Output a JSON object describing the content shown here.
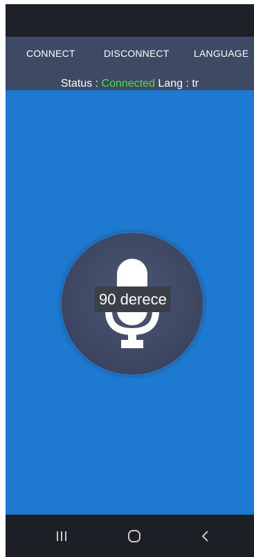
{
  "toolbar": {
    "connect_label": "CONNECT",
    "disconnect_label": "DISCONNECT",
    "language_label": "LANGUAGE"
  },
  "status": {
    "status_prefix": "Status :",
    "status_value": "Connected",
    "lang_prefix": "Lang :",
    "lang_value": "tr",
    "connected_color": "#4cde4a"
  },
  "main": {
    "background_color": "#1e7ad0",
    "mic_icon": "microphone-icon",
    "recognized_text": "90 derece"
  },
  "nav": {
    "recents_icon": "recent-apps-icon",
    "home_icon": "home-icon",
    "back_icon": "back-icon"
  }
}
